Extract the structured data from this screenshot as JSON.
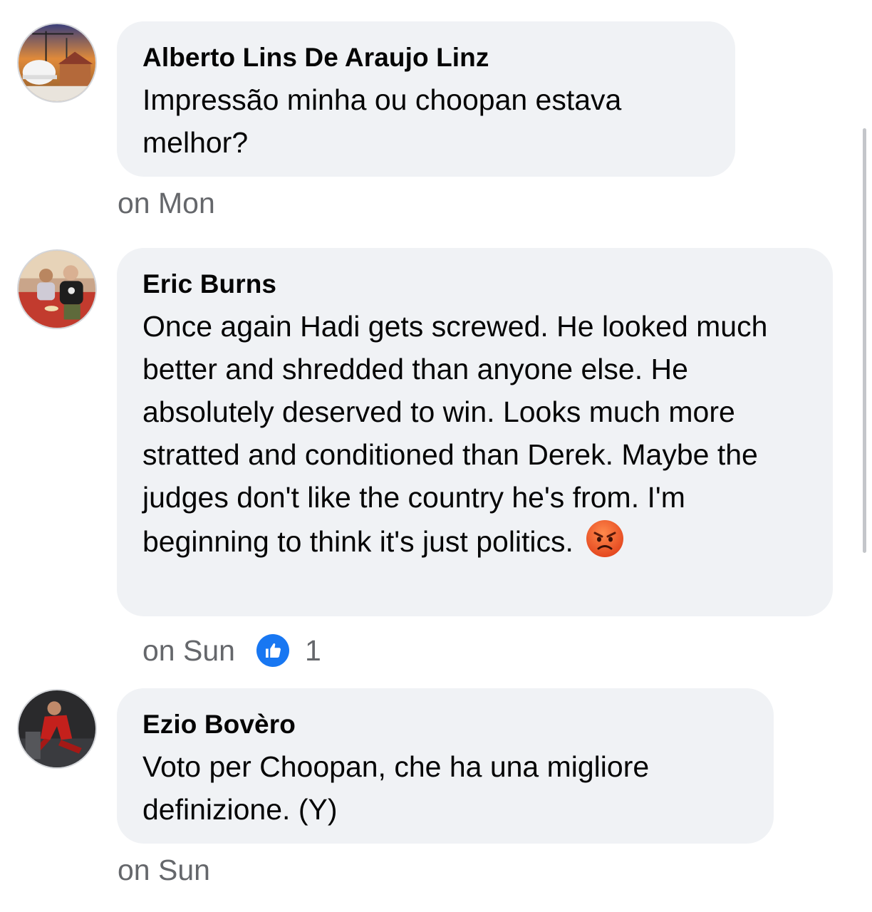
{
  "comments": [
    {
      "author": "Alberto Lins De Araujo Linz",
      "text": "Impressão minha ou choopan estava melhor?",
      "time": "on Mon",
      "avatar_icon": "construction-worker-avatar"
    },
    {
      "author": "Eric Burns",
      "text": "Once again Hadi gets screwed. He looked much better and shredded than anyone else. He absolutely deserved to win. Looks much more stratted and conditioned than Derek. Maybe the judges don't like the country he's from. I'm beginning to think it's just politics.",
      "emoji": "angry-face-emoji",
      "time": "on Sun",
      "like_icon": "thumbs-up-icon",
      "like_count": "1",
      "avatar_icon": "two-men-avatar"
    },
    {
      "author": "Ezio Bovèro",
      "text": "Voto per Choopan, che ha una migliore definizione. (Y)",
      "time": "on Sun",
      "avatar_icon": "red-figure-avatar"
    }
  ],
  "colors": {
    "bubble": "#f0f2f5",
    "meta_text": "#65676b",
    "like_blue": "#1877f2",
    "angry_orange": "#f26a2b"
  }
}
